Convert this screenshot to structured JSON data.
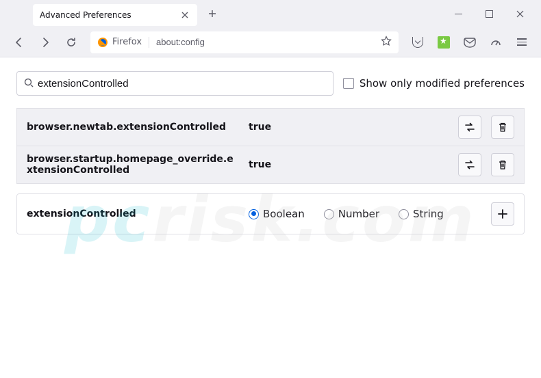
{
  "window": {
    "tab_title": "Advanced Preferences"
  },
  "toolbar": {
    "identity_label": "Firefox",
    "url": "about:config"
  },
  "search": {
    "value": "extensionControlled",
    "checkbox_label": "Show only modified preferences"
  },
  "prefs": [
    {
      "name": "browser.newtab.extensionControlled",
      "value": "true"
    },
    {
      "name": "browser.startup.homepage_override.extensionControlled",
      "value": "true"
    }
  ],
  "new_pref": {
    "name": "extensionControlled",
    "types": {
      "boolean": "Boolean",
      "number": "Number",
      "string": "String"
    }
  },
  "watermark": {
    "left": "pc",
    "right": "risk.com"
  }
}
